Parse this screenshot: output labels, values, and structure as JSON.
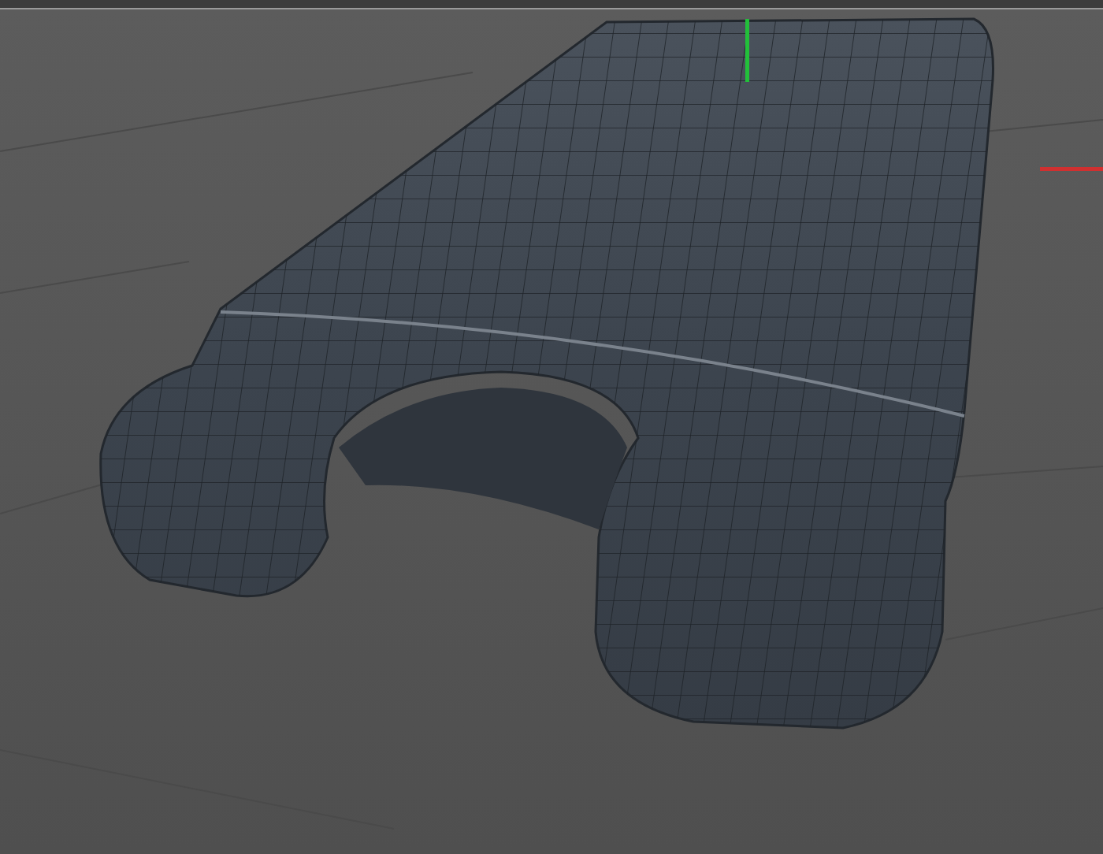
{
  "viewport": {
    "axes": [
      {
        "kind": "vertical",
        "color": "#22c03a"
      },
      {
        "kind": "horizontal",
        "color": "#d03030"
      }
    ]
  }
}
